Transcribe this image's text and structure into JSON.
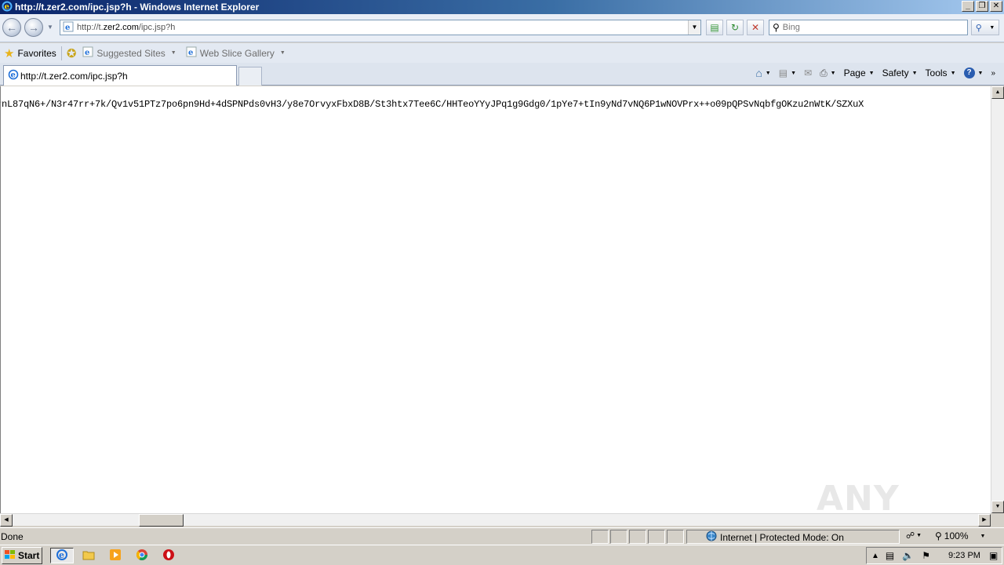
{
  "window": {
    "title": "http://t.zer2.com/ipc.jsp?h - Windows Internet Explorer",
    "minimize": "_",
    "restore": "❐",
    "close": "✕"
  },
  "address": {
    "url_prefix": "http://t.",
    "url_host": "zer2.com",
    "url_path": "/ipc.jsp?h"
  },
  "search": {
    "placeholder": "Bing"
  },
  "favorites_bar": {
    "favorites_label": "Favorites",
    "items": [
      {
        "label": "Suggested Sites"
      },
      {
        "label": "Web Slice Gallery"
      }
    ]
  },
  "tab": {
    "label": "http://t.zer2.com/ipc.jsp?h"
  },
  "command_bar": {
    "page": "Page",
    "safety": "Safety",
    "tools": "Tools"
  },
  "content": {
    "text": "?nL87qN6+/N3r47rr+7k/Qv1v51PTz7po6pn9Hd+4dSPNPds0vH3/y8e7OrvyxFbxD8B/St3htx7Tee6C/HHTeoYYyJPq1g9Gdg0/1pYe7+tIn9yNd7vNQ6P1wNOVPrx++o09pQPSvNqbfgOKzu2nWtK/SZXuX",
    "watermark": "ANY RUN"
  },
  "status_bar": {
    "status": "Done",
    "zone": "Internet | Protected Mode: On",
    "zoom": "100%"
  },
  "taskbar": {
    "start": "Start",
    "clock": "9:23 PM"
  },
  "colors": {
    "titlebar_start": "#0a246a",
    "titlebar_end": "#a6caf0",
    "chrome_bg": "#d4d0c8"
  }
}
